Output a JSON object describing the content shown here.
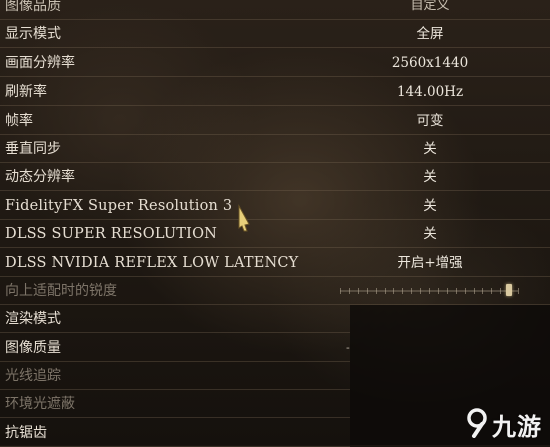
{
  "settings": {
    "header": {
      "label": "图像品质",
      "value": "自定义"
    },
    "rows": [
      {
        "label": "显示模式",
        "value": "全屏"
      },
      {
        "label": "画面分辨率",
        "value": "2560x1440"
      },
      {
        "label": "刷新率",
        "value": "144.00Hz"
      },
      {
        "label": "帧率",
        "value": "可变"
      },
      {
        "label": "垂直同步",
        "value": "关"
      },
      {
        "label": "动态分辨率",
        "value": "关"
      },
      {
        "label": "FidelityFX Super Resolution 3",
        "value": "关"
      },
      {
        "label": "DLSS SUPER RESOLUTION",
        "value": "关"
      },
      {
        "label": "DLSS NVIDIA REFLEX LOW LATENCY",
        "value": "开启+增强"
      }
    ],
    "sharpness": {
      "label": "向上适配时的锐度",
      "level": 0.95
    },
    "lower_rows": [
      {
        "label": "渲染模式"
      },
      {
        "label": "图像质量"
      },
      {
        "label": "光线追踪"
      },
      {
        "label": "环境光遮蔽"
      },
      {
        "label": "抗锯齿"
      }
    ]
  },
  "watermark": {
    "text": "九游",
    "icon": "jiuyou-logo-icon"
  },
  "colors": {
    "text": "#e6ded2",
    "dim_text": "#7d7468",
    "accent": "#d9c9a0"
  }
}
